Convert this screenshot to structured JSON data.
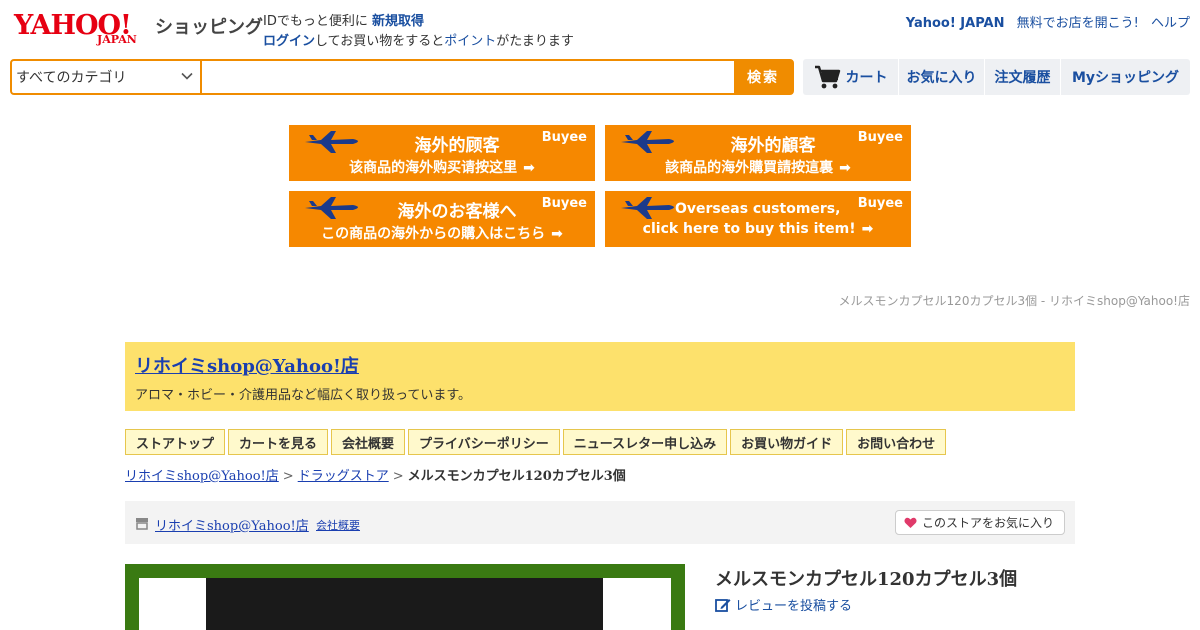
{
  "header": {
    "logo_main": "YAHOO!",
    "logo_sub": "JAPAN",
    "service_name": "ショッピング",
    "login_line1_prefix": "IDでもっと便利に",
    "signup_link": "新規取得",
    "login_link": "ログイン",
    "login_line2_mid": "してお買い物をすると",
    "points_link": "ポイント",
    "login_line2_suffix": "がたまります",
    "top_links": [
      "Yahoo! JAPAN",
      "無料でお店を開こう!",
      "ヘルプ"
    ]
  },
  "search": {
    "category": "すべてのカテゴリ",
    "query": "",
    "placeholder": "",
    "button": "検索"
  },
  "userbar": {
    "cart": "カート",
    "favorites": "お気に入り",
    "history": "注文履歴",
    "my_shopping": "Myショッピング"
  },
  "banners": [
    {
      "line1": "海外的顾客",
      "line2": "该商品的海外购买请按这里",
      "brand": "Buyee"
    },
    {
      "line1": "海外的顧客",
      "line2": "該商品的海外購買請按這裏",
      "brand": "Buyee"
    },
    {
      "line1": "海外のお客様へ",
      "line2": "この商品の海外からの購入はこちら",
      "brand": "Buyee"
    },
    {
      "line1": "Overseas customers,",
      "line2": "click here to buy this item!",
      "brand": "Buyee"
    }
  ],
  "page_title": "メルスモンカプセル120カプセル3個 - リホイミshop@Yahoo!店",
  "store": {
    "name": "リホイミshop@Yahoo!店",
    "description": "アロマ・ホビー・介護用品など幅広く取り扱っています。",
    "nav": [
      "ストアトップ",
      "カートを見る",
      "会社概要",
      "プライバシーポリシー",
      "ニュースレター申し込み",
      "お買い物ガイド",
      "お問い合わせ"
    ],
    "corp_link": "会社概要",
    "fav_button": "このストアをお気に入り"
  },
  "breadcrumb": {
    "items": [
      "リホイミshop@Yahoo!店",
      "ドラッグストア"
    ],
    "current": "メルスモンカプセル120カプセル3個",
    "separator": ">"
  },
  "product": {
    "title": "メルスモンカプセル120カプセル3個",
    "review_link": "レビューを投稿する"
  },
  "colors": {
    "accent": "#f08c00",
    "link": "#1a4fa0",
    "store_header": "#fde16c",
    "logo_red": "#e60012"
  }
}
